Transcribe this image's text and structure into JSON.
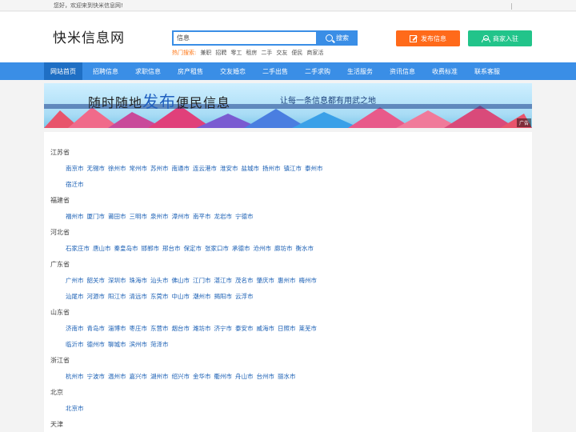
{
  "topbar": {
    "welcome": "您好，欢迎来到快米信息网!"
  },
  "header": {
    "logo": "快米信息网",
    "search": {
      "value": "信息",
      "button": "搜索"
    },
    "hot": {
      "label": "热门搜索:",
      "terms": [
        "兼职",
        "招聘",
        "零工",
        "租房",
        "二手",
        "交友",
        "便民",
        "商家活"
      ]
    },
    "publish_button": "发布信息",
    "merchant_button": "商家入驻"
  },
  "nav": [
    "网站首页",
    "招聘信息",
    "求职信息",
    "房产租售",
    "交友婚恋",
    "二手出售",
    "二手求购",
    "生活服务",
    "资讯信息",
    "收费标准",
    "联系客服"
  ],
  "banner": {
    "title_pre": "随时随地",
    "title_big": "发布",
    "title_post": "便民信息",
    "slogan": "让每一条信息都有用武之地",
    "ad": "广告"
  },
  "colors": {
    "accent": "#3a8ee6",
    "publish": "#ff6a1a",
    "merchant": "#22c48a",
    "link": "#1a5fb4"
  },
  "provinces": [
    {
      "name": "江苏省",
      "rows": [
        [
          "南京市",
          "无锡市",
          "徐州市",
          "常州市",
          "苏州市",
          "南通市",
          "连云港市",
          "淮安市",
          "盐城市",
          "扬州市",
          "镇江市",
          "泰州市"
        ],
        [
          "宿迁市"
        ]
      ]
    },
    {
      "name": "福建省",
      "rows": [
        [
          "福州市",
          "厦门市",
          "莆田市",
          "三明市",
          "泉州市",
          "漳州市",
          "南平市",
          "龙岩市",
          "宁德市"
        ]
      ]
    },
    {
      "name": "河北省",
      "rows": [
        [
          "石家庄市",
          "唐山市",
          "秦皇岛市",
          "邯郸市",
          "邢台市",
          "保定市",
          "张家口市",
          "承德市",
          "沧州市",
          "廊坊市",
          "衡水市"
        ]
      ]
    },
    {
      "name": "广东省",
      "rows": [
        [
          "广州市",
          "韶关市",
          "深圳市",
          "珠海市",
          "汕头市",
          "佛山市",
          "江门市",
          "湛江市",
          "茂名市",
          "肇庆市",
          "惠州市",
          "梅州市"
        ],
        [
          "汕尾市",
          "河源市",
          "阳江市",
          "清远市",
          "东莞市",
          "中山市",
          "潮州市",
          "揭阳市",
          "云浮市"
        ]
      ]
    },
    {
      "name": "山东省",
      "rows": [
        [
          "济南市",
          "青岛市",
          "淄博市",
          "枣庄市",
          "东营市",
          "烟台市",
          "潍坊市",
          "济宁市",
          "泰安市",
          "威海市",
          "日照市",
          "莱芜市"
        ],
        [
          "临沂市",
          "德州市",
          "聊城市",
          "滨州市",
          "菏泽市"
        ]
      ]
    },
    {
      "name": "浙江省",
      "rows": [
        [
          "杭州市",
          "宁波市",
          "温州市",
          "嘉兴市",
          "湖州市",
          "绍兴市",
          "金华市",
          "衢州市",
          "舟山市",
          "台州市",
          "丽水市"
        ]
      ]
    },
    {
      "name": "北京",
      "rows": [
        [
          "北京市"
        ]
      ]
    },
    {
      "name": "天津",
      "rows": []
    }
  ]
}
